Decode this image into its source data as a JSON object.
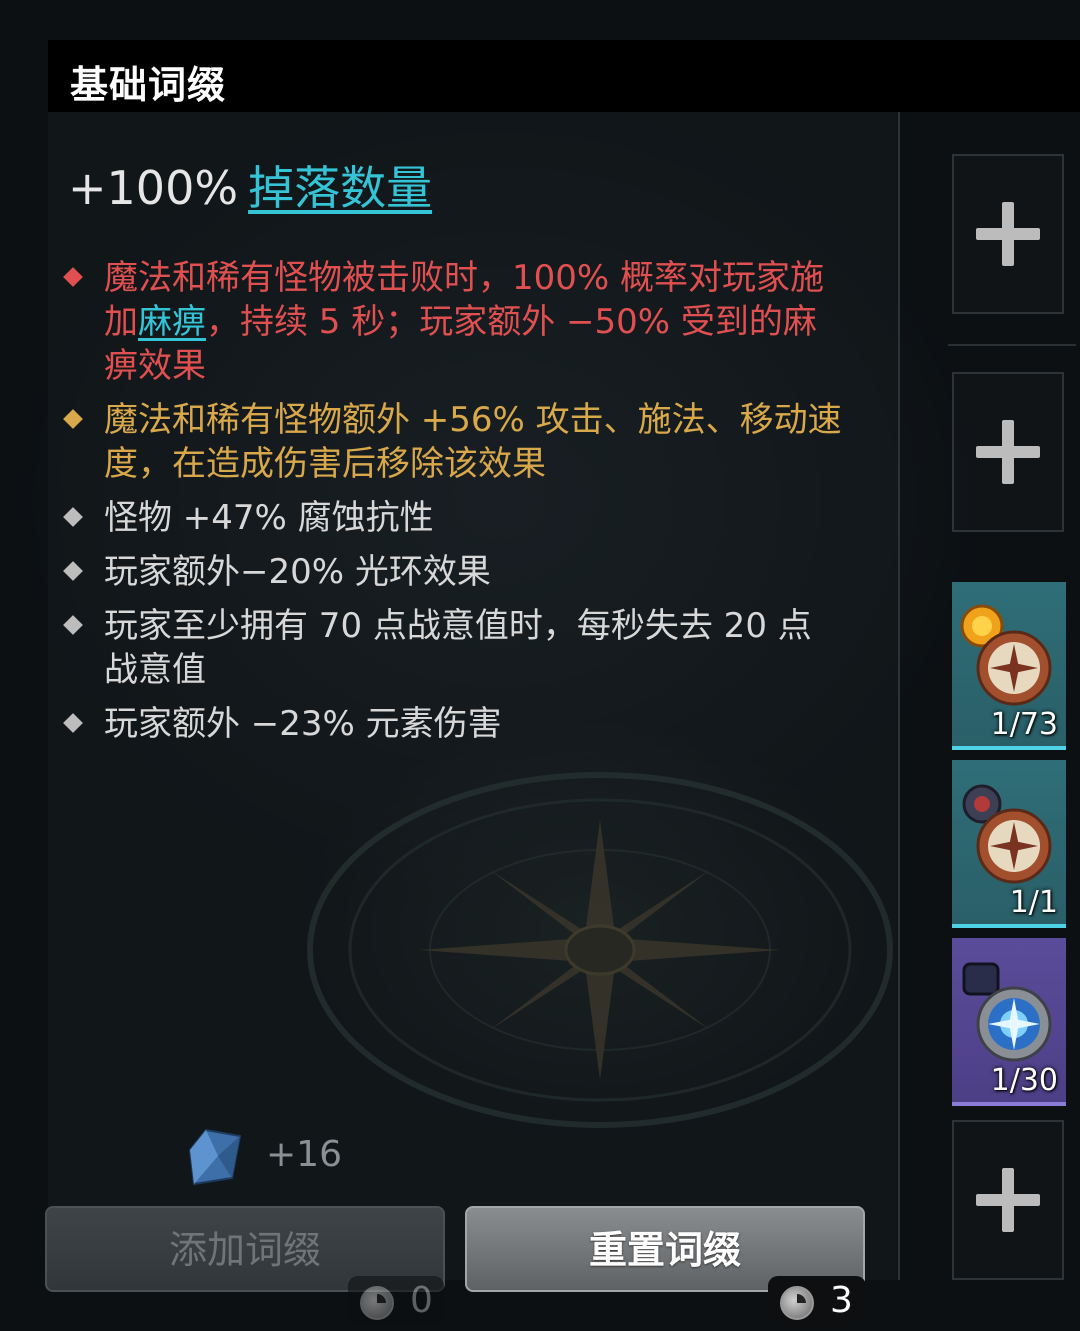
{
  "header": {
    "title": "基础词缀"
  },
  "affix": {
    "value": "+100%",
    "name": "掉落数量"
  },
  "mods": [
    {
      "color": "red",
      "pre": "魔法和稀有怪物被击败时，100% 概率对玩家施加",
      "link": "麻痹",
      "post": "，持续 5 秒；玩家额外 −50% 受到的麻痹效果"
    },
    {
      "color": "gold",
      "pre": "魔法和稀有怪物额外 +56% 攻击、施法、移动速度，在造成伤害后移除该效果",
      "link": "",
      "post": ""
    },
    {
      "color": "white",
      "pre": "怪物 +47% 腐蚀抗性",
      "link": "",
      "post": ""
    },
    {
      "color": "white",
      "pre": "玩家额外−20% 光环效果",
      "link": "",
      "post": ""
    },
    {
      "color": "white",
      "pre": "玩家至少拥有 70 点战意值时，每秒失去 20 点战意值",
      "link": "",
      "post": ""
    },
    {
      "color": "white",
      "pre": "玩家额外 −23% 元素伤害",
      "link": "",
      "post": ""
    }
  ],
  "slots": {
    "items": [
      {
        "count": "1/73",
        "icon": "compass-orange-icon"
      },
      {
        "count": "1/1",
        "icon": "compass-dark-icon"
      },
      {
        "count": "1/30",
        "icon": "compass-blue-icon"
      }
    ]
  },
  "resource": {
    "count": "+16",
    "icon": "crystal-shard-icon"
  },
  "buttons": {
    "add_label": "添加词缀",
    "reset_label": "重置词缀",
    "add_cost": "0",
    "reset_cost": "3"
  },
  "colors": {
    "link": "#35c4d6",
    "red_mod": "#e05050",
    "gold_mod": "#d8a84a"
  }
}
